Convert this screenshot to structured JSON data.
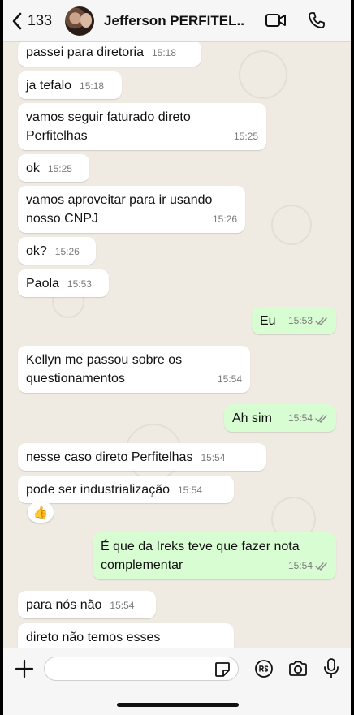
{
  "header": {
    "back_count": "133",
    "contact_name": "Jefferson PERFITEL..."
  },
  "messages": [
    {
      "dir": "in",
      "text": "passei para diretoria",
      "time": "15:18"
    },
    {
      "dir": "in",
      "text": "ja tefalo",
      "time": "15:18"
    },
    {
      "dir": "in",
      "text": "vamos seguir faturado direto Perfitelhas",
      "time": "15:25"
    },
    {
      "dir": "in",
      "text": "ok",
      "time": "15:25"
    },
    {
      "dir": "in",
      "text": "vamos aproveitar para ir usando nosso CNPJ",
      "time": "15:26"
    },
    {
      "dir": "in",
      "text": "ok?",
      "time": "15:26"
    },
    {
      "dir": "in",
      "text": "Paola",
      "time": "15:53"
    },
    {
      "dir": "out",
      "text": "Eu",
      "time": "15:53"
    },
    {
      "dir": "in",
      "text": "Kellyn me passou sobre os questionamentos",
      "time": "15:54"
    },
    {
      "dir": "out",
      "text": "Ah sim",
      "time": "15:54"
    },
    {
      "dir": "in",
      "text": "nesse caso direto Perfitelhas",
      "time": "15:54"
    },
    {
      "dir": "in",
      "text": "pode ser industrialização",
      "time": "15:54",
      "reaction": "👍"
    },
    {
      "dir": "out",
      "text": "É que da Ireks teve que fazer nota complementar",
      "time": "15:54"
    },
    {
      "dir": "in",
      "text": "para nós não",
      "time": "15:54"
    },
    {
      "dir": "in",
      "text": "direto não temos esses",
      "time": ""
    }
  ],
  "composer": {
    "placeholder": ""
  },
  "colors": {
    "incoming": "#ffffff",
    "outgoing": "#d9fdd3",
    "read_ticks": "#53bdeb"
  }
}
